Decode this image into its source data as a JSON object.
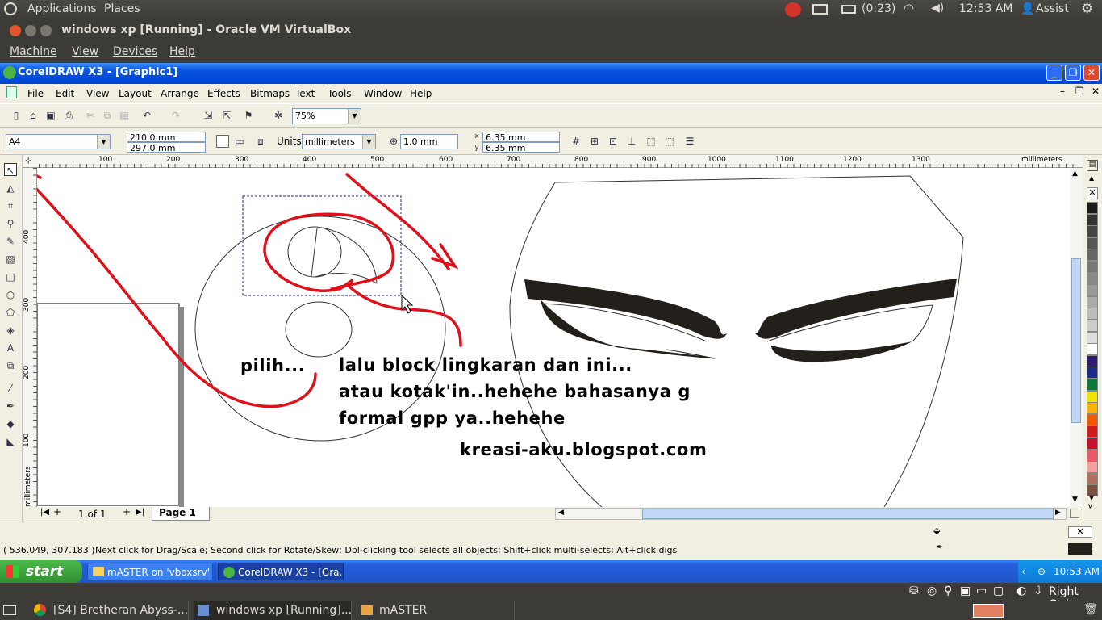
{
  "ubuntu_panel": {
    "applications": "Applications",
    "places": "Places",
    "battery": "(0:23)",
    "time": "12:53 AM",
    "user": "Assist"
  },
  "vbox": {
    "title": "windows xp [Running] - Oracle VM VirtualBox",
    "menu": [
      "Machine",
      "View",
      "Devices",
      "Help"
    ],
    "host_key": "Right Ctrl"
  },
  "corel": {
    "title": "CorelDRAW X3 - [Graphic1]",
    "menu": [
      "File",
      "Edit",
      "View",
      "Layout",
      "Arrange",
      "Effects",
      "Bitmaps",
      "Text",
      "Tools",
      "Window",
      "Help"
    ],
    "zoom": "75%",
    "paper": "A4",
    "width": "210.0 mm",
    "height": "297.0 mm",
    "units_label": "Units:",
    "units": "millimeters",
    "nudge": "1.0 mm",
    "dup_x": "6.35 mm",
    "dup_y": "6.35 mm",
    "ruler_units": "millimeters",
    "hruler_ticks": [
      "100",
      "200",
      "300",
      "400",
      "500",
      "600",
      "700",
      "800",
      "900",
      "1000",
      "1100",
      "1200",
      "1300"
    ],
    "vruler_ticks": [
      "400",
      "300",
      "200",
      "100"
    ],
    "page_count": "1 of 1",
    "page_tab": "Page 1",
    "coords": "( 536.049, 307.183 )",
    "status_text": "Next click for Drag/Scale; Second click for Rotate/Skew; Dbl-clicking tool selects all objects; Shift+click multi-selects; Alt+click digs"
  },
  "annotations": {
    "pilih": "pilih...",
    "line1": "lalu block lingkaran dan ini...",
    "line2": "atau kotak'in..hehehe bahasanya g",
    "line3": "formal gpp ya..hehehe",
    "blog": "kreasi-aku.blogspot.com"
  },
  "xp_taskbar": {
    "start": "start",
    "task1": "mASTER on 'vboxsrv' ...",
    "task2": "CorelDRAW X3 - [Gra...",
    "clock": "10:53 AM"
  },
  "ubuntu_bottom": {
    "t1": "[S4] Bretheran Abyss-...",
    "t2": "windows xp [Running]...",
    "t3": "mASTER"
  },
  "colors": {
    "xp_title": "#0a54e3",
    "annotation_red": "#e0101a",
    "palette": [
      "#ffffff",
      "#1a1a1a",
      "#333333",
      "#444444",
      "#555555",
      "#666666",
      "#777777",
      "#888888",
      "#999999",
      "#aaaaaa",
      "#bbbbbb",
      "#cccccc",
      "#dddddd",
      "#ffffff",
      "#2e1a6e",
      "#1d2b8c",
      "#0a7a3a",
      "#f0e400",
      "#f7b500",
      "#f05a00",
      "#d11a1a",
      "#c8102e",
      "#e85a6a",
      "#f4a0a0",
      "#b07060",
      "#7a5040"
    ]
  }
}
